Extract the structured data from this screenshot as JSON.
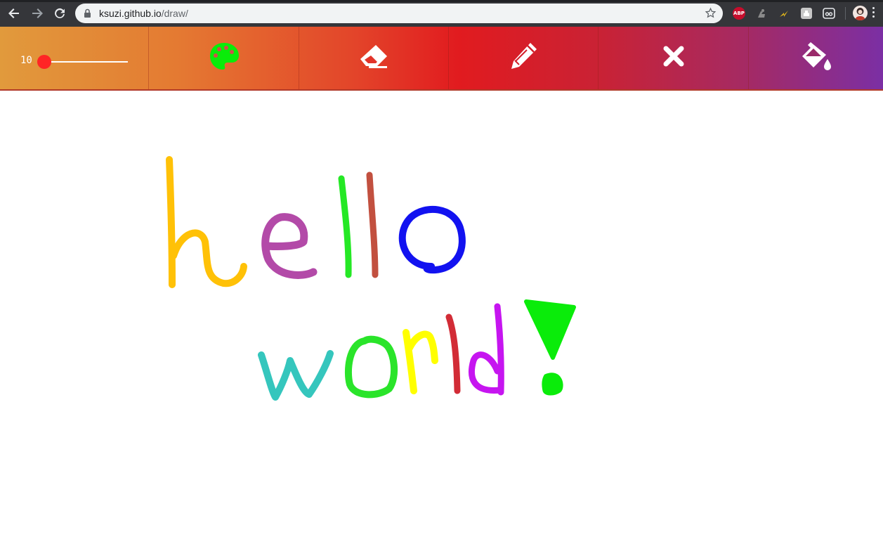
{
  "browser": {
    "url_host": "ksuzi.github.io",
    "url_path": "/draw/",
    "icons": [
      "back-arrow-icon",
      "forward-arrow-icon",
      "reload-icon",
      "lock-icon",
      "star-icon",
      "adblock-plus-icon",
      "extension-icon",
      "extension-icon",
      "extension-icon",
      "extension-icon",
      "profile-avatar",
      "menu-icon"
    ],
    "abp_label": "ABP"
  },
  "toolbar": {
    "brush_size": "10",
    "brush_size_value": 10,
    "brush_size_range": [
      0,
      100
    ],
    "slider_thumb_color": "#ff2525",
    "current_color": "#0aec0a",
    "tools": [
      {
        "name": "color-palette",
        "icon": "palette-icon"
      },
      {
        "name": "eraser",
        "icon": "eraser-icon"
      },
      {
        "name": "pencil",
        "icon": "pencil-icon"
      },
      {
        "name": "clear",
        "icon": "close-icon"
      },
      {
        "name": "fill",
        "icon": "paint-bucket-icon"
      }
    ]
  },
  "drawing": {
    "content": "hello world!",
    "stroke_colors": {
      "h": "#ffc107",
      "e": "#b34aa8",
      "l1": "#25e825",
      "l2": "#c2503f",
      "o": "#1212f0",
      "w": "#35c6bd",
      "o2": "#2ae42a",
      "r": "#ffff00",
      "l3": "#d22c36",
      "d": "#c615f0",
      "exclamation": "#0aec0a"
    }
  }
}
